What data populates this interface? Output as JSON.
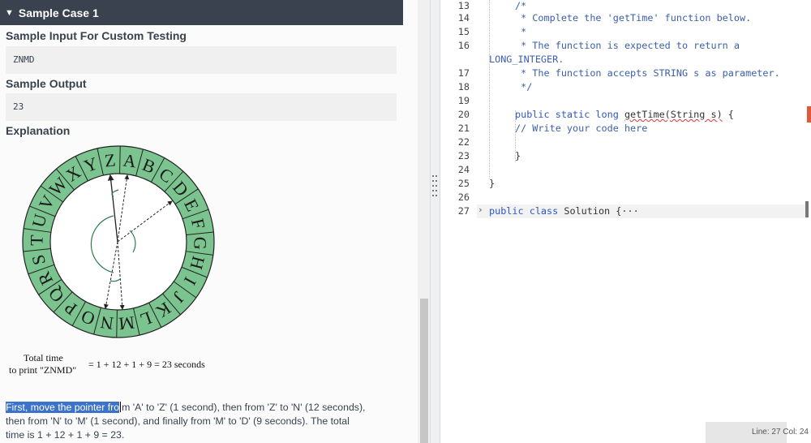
{
  "sample": {
    "header": "Sample Case 1",
    "input_title": "Sample Input For Custom Testing",
    "input_value": "ZNMD",
    "output_title": "Sample Output",
    "output_value": "23",
    "explanation_title": "Explanation"
  },
  "wheel": {
    "letters": [
      "A",
      "B",
      "C",
      "D",
      "E",
      "F",
      "G",
      "H",
      "I",
      "J",
      "K",
      "L",
      "M",
      "N",
      "O",
      "P",
      "Q",
      "R",
      "S",
      "T",
      "U",
      "V",
      "W",
      "X",
      "Y",
      "Z"
    ],
    "fill_color": "#7cc48f",
    "inner_color": "#ffffff"
  },
  "caption": {
    "line1": "Total time",
    "line2": "to print \"ZNMD\"",
    "formula": "= 1 + 12 + 1 + 9 = 23 seconds"
  },
  "explanation": {
    "highlighted": "First, move the pointer fro",
    "rest1": "m 'A' to 'Z' (1 second), then from 'Z' to 'N' (12 seconds),",
    "line2": "then from 'N' to 'M' (1 second), and finally from 'M' to 'D' (9 seconds). The total",
    "line3": "time is 1 + 12 + 1 + 9 = 23."
  },
  "editor": {
    "lines": [
      {
        "n": "13",
        "text": "/*"
      },
      {
        "n": "14",
        "text": " * Complete the 'getTime' function below."
      },
      {
        "n": "15",
        "text": " *"
      },
      {
        "n": "16",
        "text": " * The function is expected to return a"
      },
      {
        "n": "",
        "text": "LONG_INTEGER."
      },
      {
        "n": "17",
        "text": " * The function accepts STRING s as parameter."
      },
      {
        "n": "18",
        "text": " */"
      },
      {
        "n": "19",
        "text": ""
      },
      {
        "n": "20",
        "kw": "public static long ",
        "name": "getTime(String s)",
        "tail": " {"
      },
      {
        "n": "21",
        "text": "// Write your code here"
      },
      {
        "n": "22",
        "text": ""
      },
      {
        "n": "23",
        "text": "}"
      },
      {
        "n": "24",
        "text": ""
      },
      {
        "n": "25",
        "text": "}"
      },
      {
        "n": "26",
        "text": ""
      },
      {
        "n": "27",
        "kw": "public class ",
        "name": "Solution ",
        "tail": "{···"
      }
    ],
    "fold_icon": "chevron-right-icon",
    "status": "Line: 27 Col: 24"
  }
}
